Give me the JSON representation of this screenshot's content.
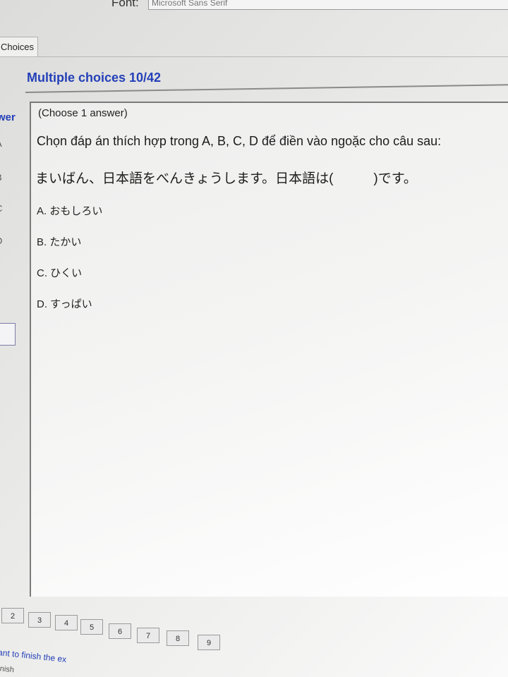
{
  "toolbar": {
    "font_label": "Font:",
    "font_value": "Microsoft Sans Serif"
  },
  "tabs": [
    {
      "label": "Choices"
    }
  ],
  "header": {
    "title": "Multiple choices 10/42"
  },
  "sidebar": {
    "answer_label": "wer",
    "option_keys": [
      "A",
      "B",
      "C",
      "D"
    ]
  },
  "question": {
    "instruction": "(Choose 1 answer)",
    "prompt": "Chọn đáp án thích hợp trong A, B, C, D để điền vào ngoặc cho câu sau:",
    "sentence": "まいばん、日本語をべんきょうします。日本語は(　　　)です。",
    "options": [
      {
        "label": "A. おもしろい"
      },
      {
        "label": "B. たかい"
      },
      {
        "label": "C. ひくい"
      },
      {
        "label": "D. すっぱい"
      }
    ]
  },
  "pager": {
    "pages": [
      "2",
      "3",
      "4",
      "5",
      "6",
      "7",
      "8",
      "9"
    ]
  },
  "footer": {
    "finish_text": "ant to finish the ex",
    "finish_text_2": "inish"
  }
}
